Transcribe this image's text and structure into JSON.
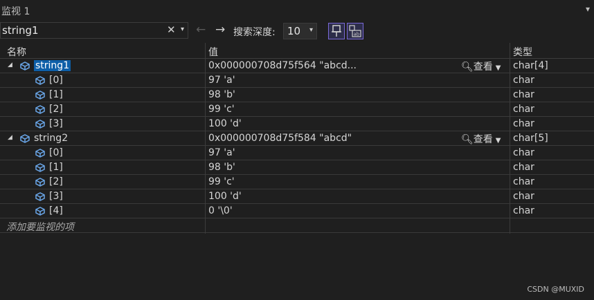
{
  "window": {
    "title": "监视 1",
    "menu_glyph": "▾"
  },
  "toolbar": {
    "search_value": "string1",
    "clear_glyph": "✕",
    "dropdown_glyph": "▾",
    "back_glyph": "←",
    "forward_glyph": "→",
    "depth_label": "搜索深度:",
    "depth_value": "10",
    "depth_arrow": "▾"
  },
  "columns": {
    "name": "名称",
    "value": "值",
    "type": "类型"
  },
  "view_label": "查看",
  "rows": [
    {
      "name": "string1",
      "value": "0x000000708d75f564 \"abcd...",
      "type": "char[4]",
      "level": 0,
      "expanded": true,
      "selected": true,
      "has_view": true
    },
    {
      "name": "[0]",
      "value": "97 'a'",
      "type": "char",
      "level": 1
    },
    {
      "name": "[1]",
      "value": "98 'b'",
      "type": "char",
      "level": 1
    },
    {
      "name": "[2]",
      "value": "99 'c'",
      "type": "char",
      "level": 1
    },
    {
      "name": "[3]",
      "value": "100 'd'",
      "type": "char",
      "level": 1
    },
    {
      "name": "string2",
      "value": "0x000000708d75f584 \"abcd\"",
      "type": "char[5]",
      "level": 0,
      "expanded": true,
      "has_view": true
    },
    {
      "name": "[0]",
      "value": "97 'a'",
      "type": "char",
      "level": 1
    },
    {
      "name": "[1]",
      "value": "98 'b'",
      "type": "char",
      "level": 1
    },
    {
      "name": "[2]",
      "value": "99 'c'",
      "type": "char",
      "level": 1
    },
    {
      "name": "[3]",
      "value": "100 'd'",
      "type": "char",
      "level": 1
    },
    {
      "name": "[4]",
      "value": "0 '\\0'",
      "type": "char",
      "level": 1
    }
  ],
  "add_watch_label": "添加要监视的项",
  "watermark": "CSDN @MUXID",
  "colors": {
    "selection": "#0e5fa8",
    "icon": "#6aa6e8",
    "accent": "#7b6ad8"
  }
}
